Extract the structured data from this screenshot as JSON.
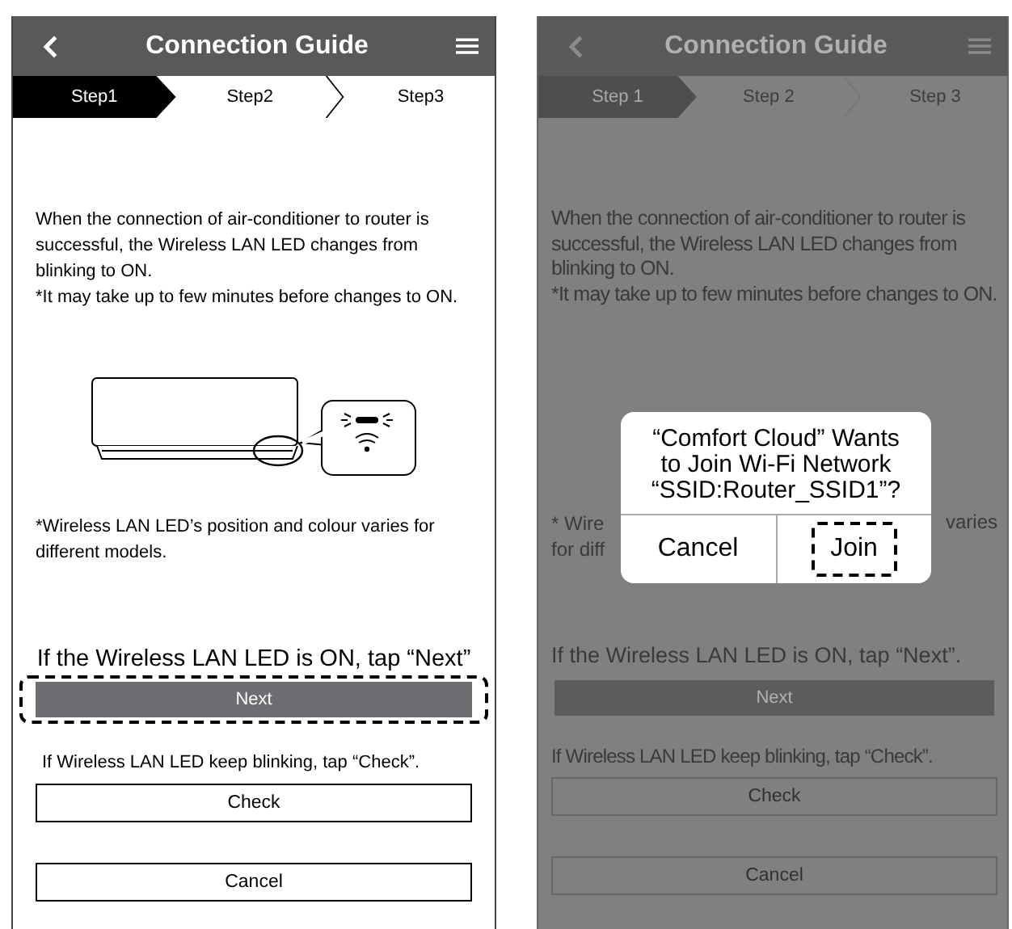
{
  "screens": [
    {
      "dimmed": false,
      "title": "Connection Guide",
      "steps": [
        {
          "label": "Step1",
          "selected": true
        },
        {
          "label": "Step2",
          "selected": false
        },
        {
          "label": "Step3",
          "selected": false
        }
      ],
      "message": [
        "When the connection of air-conditioner to router is successful, the Wireless LAN LED changes from blinking to ON.",
        "*It may take up to few minutes before changes to ON."
      ],
      "note": "*Wireless LAN LED’s position and colour varies for different models.",
      "next_hint": "If the Wireless LAN LED is ON, tap “Next”",
      "next_button": {
        "label": "Next",
        "highlighted": true
      },
      "check_hint": "If Wireless LAN LED keep blinking, tap “Check”.",
      "check_button": "Check",
      "cancel_button": "Cancel"
    },
    {
      "dimmed": true,
      "title": "Connection Guide",
      "steps": [
        {
          "label": "Step 1",
          "selected": true
        },
        {
          "label": "Step 2",
          "selected": false
        },
        {
          "label": "Step 3",
          "selected": false
        }
      ],
      "message": [
        "When the connection of air-conditioner to router is successful, the Wireless LAN LED changes from blinking to ON.",
        "*It may take up to few minutes before changes to ON."
      ],
      "note_fragments": {
        "left": [
          "* Wire",
          "for diff"
        ],
        "right": "varies"
      },
      "next_hint": "If the Wireless LAN LED is ON, tap “Next”.",
      "next_button": {
        "label": "Next",
        "highlighted": false
      },
      "check_hint": "If Wireless LAN LED keep blinking, tap “Check”.",
      "check_button": "Check",
      "cancel_button": "Cancel",
      "dialog": {
        "lines": [
          "“Comfort Cloud” Wants",
          "to Join Wi-Fi Network",
          "“SSID:Router_SSID1”?"
        ],
        "buttons": [
          {
            "label": "Cancel",
            "highlighted": false
          },
          {
            "label": "Join",
            "highlighted": true
          }
        ]
      }
    }
  ]
}
